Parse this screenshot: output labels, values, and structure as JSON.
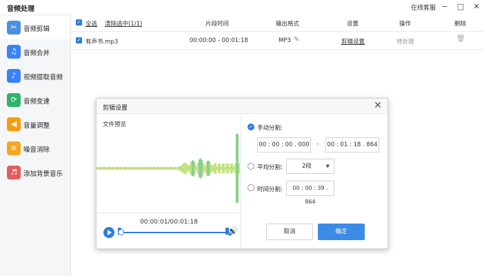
{
  "app": {
    "title": "音频处理",
    "service": "在线客服"
  },
  "window": {
    "minimize": "−",
    "maximize": "□",
    "close": "✕"
  },
  "sidebar": {
    "items": [
      {
        "label": "音频剪辑",
        "icon": "scissors-icon",
        "color": "#4a90e2",
        "glyph": "✂"
      },
      {
        "label": "音频合并",
        "icon": "merge-music-icon",
        "color": "#3b82f6",
        "glyph": "♫"
      },
      {
        "label": "视频提取音频",
        "icon": "extract-audio-icon",
        "color": "#3b82f6",
        "glyph": "♪"
      },
      {
        "label": "音频变速",
        "icon": "speed-icon",
        "color": "#2fb36a",
        "glyph": "⟳"
      },
      {
        "label": "音量调整",
        "icon": "volume-icon",
        "color": "#f59e0b",
        "glyph": "◀"
      },
      {
        "label": "噪音消除",
        "icon": "noise-icon",
        "color": "#f5a623",
        "glyph": "≋"
      },
      {
        "label": "添加背景音乐",
        "icon": "bg-music-icon",
        "color": "#e25d5d",
        "glyph": "♬"
      }
    ]
  },
  "table": {
    "headers": {
      "select_all": "全选",
      "clear": "清除选中(1/1)",
      "segment": "片段时间",
      "format": "输出格式",
      "settings": "设置",
      "action": "操作",
      "delete": "删除"
    },
    "rows": [
      {
        "name": "有声书.mp3",
        "time": "00:00:00 - 00:01:18",
        "format": "MP3",
        "settings": "剪辑设置",
        "action": "待处理"
      }
    ]
  },
  "dialog": {
    "title": "剪辑设置",
    "preview_label": "文件预览",
    "player_time": "00:00:01/00:01:18",
    "progress": 0.01,
    "manual": {
      "label": "手动分割:",
      "start": "00 : 00 : 00 . 000",
      "end": "00 : 01 : 18 . 864"
    },
    "average": {
      "label": "平均分割:",
      "value": "2段"
    },
    "time_split": {
      "label": "时间分割:",
      "value": "00 : 00 : 39 . 864"
    },
    "cancel": "取消",
    "ok": "确定"
  },
  "colors": {
    "accent": "#2b7de1",
    "wave_low": "#9acd32",
    "wave_high": "#3cb043"
  }
}
